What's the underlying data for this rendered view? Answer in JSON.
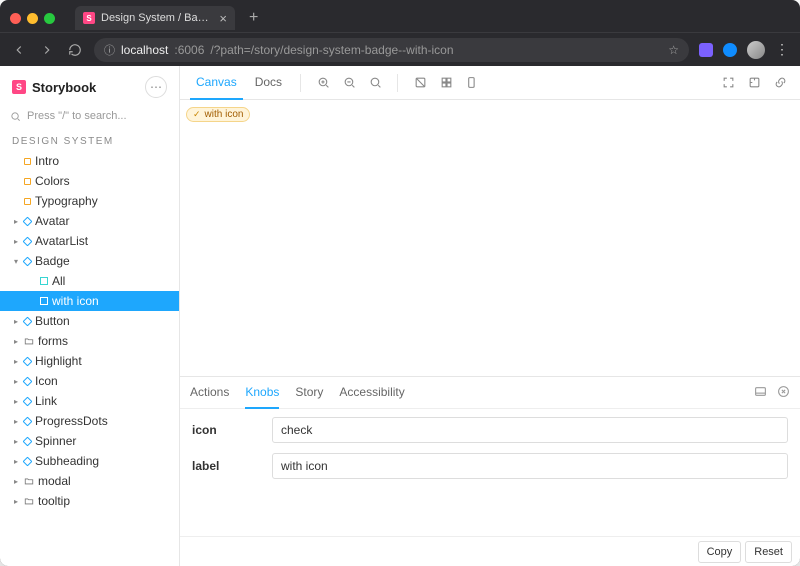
{
  "browser": {
    "tab_title": "Design System / Badge – with",
    "url_host": "localhost",
    "url_port": ":6006",
    "url_path": "/?path=/story/design-system-badge--with-icon"
  },
  "sidebar": {
    "brand": "Storybook",
    "search_placeholder": "Press \"/\" to search...",
    "group_label": "DESIGN SYSTEM",
    "items": [
      {
        "label": "Intro",
        "kind": "doc",
        "depth": 1
      },
      {
        "label": "Colors",
        "kind": "doc",
        "depth": 1
      },
      {
        "label": "Typography",
        "kind": "doc",
        "depth": 1
      },
      {
        "label": "Avatar",
        "kind": "comp",
        "depth": 1,
        "caret": true
      },
      {
        "label": "AvatarList",
        "kind": "comp",
        "depth": 1,
        "caret": true
      },
      {
        "label": "Badge",
        "kind": "comp",
        "depth": 1,
        "caret": true,
        "expanded": true
      },
      {
        "label": "All",
        "kind": "story",
        "depth": 2
      },
      {
        "label": "with icon",
        "kind": "story",
        "depth": 2,
        "selected": true
      },
      {
        "label": "Button",
        "kind": "comp",
        "depth": 1,
        "caret": true
      },
      {
        "label": "forms",
        "kind": "folder",
        "depth": 1,
        "caret": true
      },
      {
        "label": "Highlight",
        "kind": "comp",
        "depth": 1,
        "caret": true
      },
      {
        "label": "Icon",
        "kind": "comp",
        "depth": 1,
        "caret": true
      },
      {
        "label": "Link",
        "kind": "comp",
        "depth": 1,
        "caret": true
      },
      {
        "label": "ProgressDots",
        "kind": "comp",
        "depth": 1,
        "caret": true
      },
      {
        "label": "Spinner",
        "kind": "comp",
        "depth": 1,
        "caret": true
      },
      {
        "label": "Subheading",
        "kind": "comp",
        "depth": 1,
        "caret": true
      },
      {
        "label": "modal",
        "kind": "folder",
        "depth": 1,
        "caret": true
      },
      {
        "label": "tooltip",
        "kind": "folder",
        "depth": 1,
        "caret": true
      }
    ]
  },
  "toolbar": {
    "tabs": {
      "canvas": "Canvas",
      "docs": "Docs"
    }
  },
  "preview": {
    "badge_label": "with icon"
  },
  "addons": {
    "tabs": {
      "actions": "Actions",
      "knobs": "Knobs",
      "story": "Story",
      "accessibility": "Accessibility"
    },
    "knobs": [
      {
        "name": "icon",
        "value": "check"
      },
      {
        "name": "label",
        "value": "with icon"
      }
    ],
    "footer": {
      "copy": "Copy",
      "reset": "Reset"
    }
  }
}
